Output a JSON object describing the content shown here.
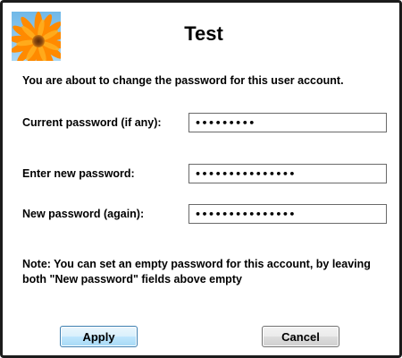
{
  "dialog": {
    "title": "Test",
    "avatar_icon": "flower-user-picture-icon"
  },
  "intro_text": "You are about to change the password for this user account.",
  "fields": {
    "current": {
      "label": "Current password (if any):",
      "value": "•••••••••"
    },
    "new": {
      "label": "Enter new password:",
      "value": "•••••••••••••••"
    },
    "again": {
      "label": "New password (again):",
      "value": "•••••••••••••••"
    }
  },
  "note": "Note: You can set an empty password for this account, by leaving both \"New password\" fields above empty",
  "buttons": {
    "apply": "Apply",
    "cancel": "Cancel"
  },
  "colors": {
    "apply_border": "#3c7fb1",
    "frame_border": "#1c1c1c"
  }
}
